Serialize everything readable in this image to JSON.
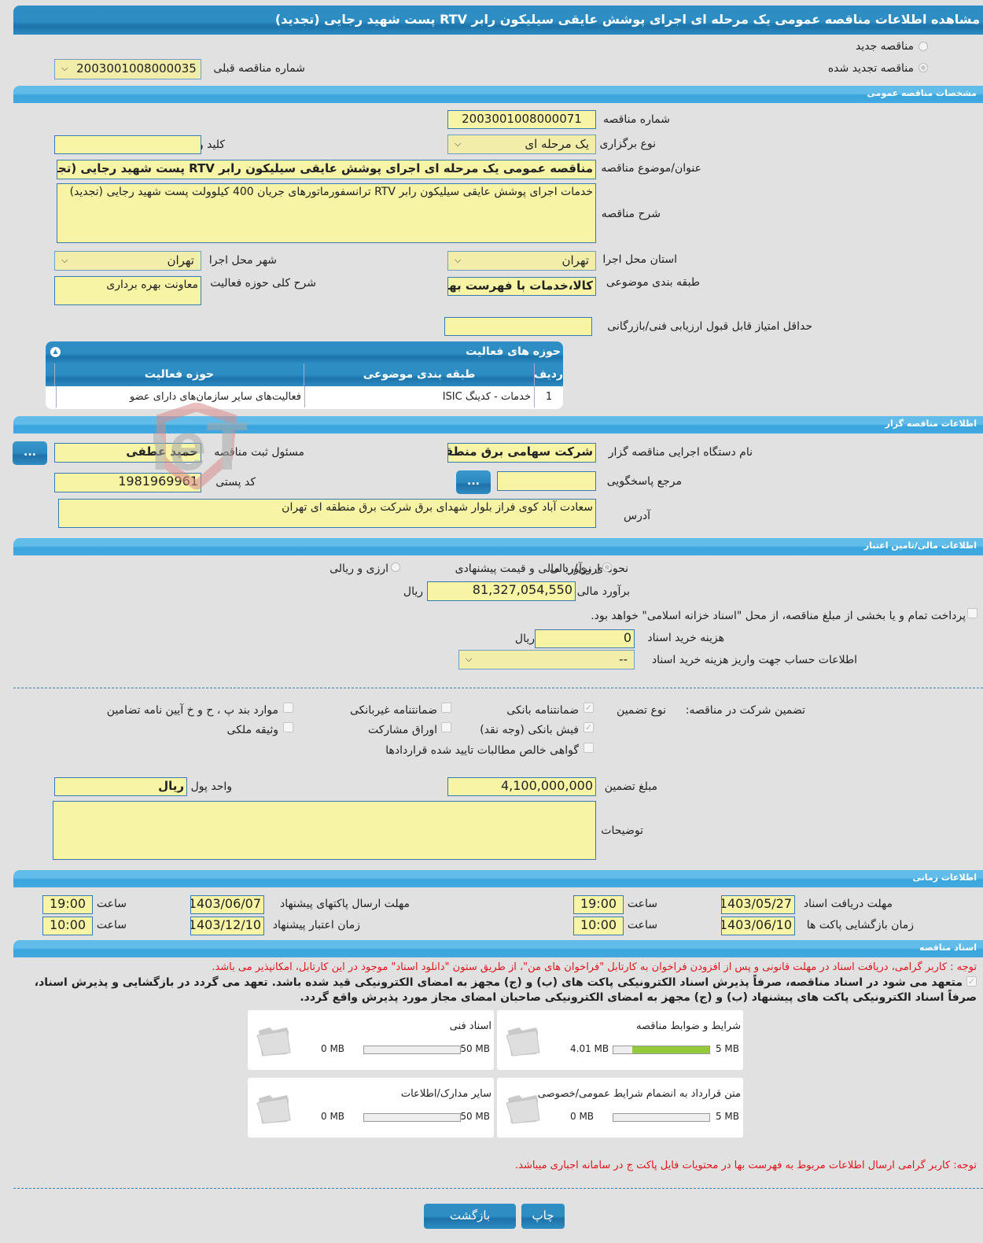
{
  "page_title": "مشاهده اطلاعات مناقصه عمومی یک مرحله ای اجرای پوشش عایقی سیلیکون رابر RTV پست شهید رجایی (تجدید)",
  "tender_type": {
    "new_label": "مناقصه جدید",
    "renewed_label": "مناقصه تجدید شده",
    "selected": "renewed",
    "previous_number_label": "شماره مناقصه قبلی",
    "previous_number": "2003001008000035"
  },
  "general": {
    "section_title": "مشخصات مناقصه عمومی",
    "number_label": "شماره مناقصه",
    "number": "2003001008000071",
    "holding_type_label": "نوع برگزاری",
    "holding_type": "یک مرحله ای",
    "keyword_label": "کلید واژه",
    "keyword": "",
    "subject_label": "عنوان/موضوع مناقصه",
    "subject": "مناقصه عمومی یک مرحله ای اجرای پوشش عایقی سیلیکون رابر RTV پست شهید رجایی (تجدید)",
    "description_label": "شرح مناقصه",
    "description": "خدمات اجرای پوشش عایقی سیلیکون رابر RTV ترانسفورماتورهای جریان 400 کیلوولت پست شهید رجایی (تجدید)",
    "province_label": "استان محل اجرا",
    "province": "تهران",
    "city_label": "شهر محل اجرا",
    "city": "تهران",
    "category_label": "طبقه بندی موضوعی",
    "category": "کالا،خدمات با فهرست بها،خ",
    "activity_scope_label": "شرح کلی حوزه فعالیت",
    "activity_scope": "معاونت بهره برداری",
    "min_score_label": "حداقل امتیاز قابل قبول ارزیابی فنی/بازرگانی",
    "min_score": ""
  },
  "activity_table": {
    "title": "حوزه های فعالیت",
    "columns": [
      "ردیف",
      "طبقه بندی موضوعی",
      "حوزه فعالیت"
    ],
    "rows": [
      [
        "1",
        "خدمات - کدینگ ISIC",
        "فعالیت‌های سایر سازمان‌های دارای عضو"
      ]
    ]
  },
  "organizer": {
    "section_title": "اطلاعات مناقصه گزار",
    "org_label": "نام دستگاه اجرایی مناقصه گزار",
    "org": "شرکت سهامی برق منطقه",
    "registrar_label": "مسئول ثبت مناقصه",
    "registrar": "حمید عطفی",
    "reference_label": "مرجع پاسخگویی",
    "reference": "",
    "postal_label": "کد پستی",
    "postal": "1981969961",
    "address_label": "آدرس",
    "address": "سعادت آباد کوی فراز بلوار شهدای برق شرکت برق منطقه ای تهران",
    "dots_label": "..."
  },
  "financial": {
    "section_title": "اطلاعات مالی/تامین اعتبار",
    "method_label": "نحوه ی برآورد مالی و قیمت پیشنهادی",
    "option_rial": "ارزی/ریالی",
    "option_both": "ارزی و ریالی",
    "estimate_label": "برآورد مالی",
    "estimate": "81,327,054,550",
    "currency": "ریال",
    "treasury_text": "پرداخت تمام و یا بخشی از مبلغ مناقصه، از محل \"اسناد خزانه اسلامی\" خواهد بود.",
    "doc_fee_label": "هزینه خرید اسناد",
    "doc_fee": "0",
    "doc_fee_currency": "ریال",
    "account_label": "اطلاعات حساب جهت واریز هزینه خرید اسناد",
    "account": "--"
  },
  "guarantee": {
    "title_label": "تضمین شرکت در مناقصه:",
    "type_label": "نوع تضمین",
    "options": [
      {
        "label": "ضمانتنامه بانکی",
        "checked": true
      },
      {
        "label": "ضمانتنامه غیربانکی",
        "checked": false
      },
      {
        "label": "موارد بند پ ، ح و خ آیین نامه تضامین",
        "checked": false
      },
      {
        "label": "فیش بانکی (وجه نقد)",
        "checked": true
      },
      {
        "label": "اوراق مشارکت",
        "checked": false
      },
      {
        "label": "وثیقه ملکی",
        "checked": false
      },
      {
        "label": "گواهی خالص مطالبات تایید شده قراردادها",
        "checked": false
      }
    ],
    "amount_label": "مبلغ تضمین",
    "amount": "4,100,000,000",
    "unit_label": "واحد پول",
    "unit": "ریال",
    "notes_label": "توضیحات",
    "notes": ""
  },
  "timing": {
    "section_title": "اطلاعات زمانی",
    "doc_deadline_label": "مهلت دریافت اسناد",
    "doc_deadline_date": "1403/05/27",
    "doc_deadline_time": "19:00",
    "submit_deadline_label": "مهلت ارسال پاکتهای پیشنهاد",
    "submit_deadline_date": "1403/06/07",
    "submit_deadline_time": "19:00",
    "opening_label": "زمان بازگشایی پاکت ها",
    "opening_date": "1403/06/10",
    "opening_time": "10:00",
    "validity_label": "زمان اعتبار پیشنهاد",
    "validity_date": "1403/12/10",
    "validity_time": "10:00",
    "time_label": "ساعت"
  },
  "documents": {
    "section_title": "اسناد مناقصه",
    "notice": "توجه : کاربر گرامی، دریافت اسناد در مهلت قانونی و پس از افزودن فراخوان به کارتابل \"فراخوان های من\"، از طریق ستون \"دانلود اسناد\" موجود در این کارتابل، امکانپذیر می باشد.",
    "commitment_line1": "متعهد می شود در اسناد مناقصه، صرفاً پذیرش اسناد الکترونیکی پاکت های (ب) و (ج) مجهز به امضای الکترونیکی قید شده باشد. تعهد می گردد در بازگشایی و پذیرش اسناد،",
    "commitment_line2": "صرفاً اسناد الکترونیکی پاکت های پیشنهاد (ب) و (ج) مجهز به امضای الکترونیکی صاحبان امضای مجاز مورد پذیرش واقع گردد.",
    "cards": [
      {
        "name": "شرایط و ضوابط مناقصه",
        "used": "4.01 MB",
        "max": "5 MB",
        "fill_fraction": 0.8
      },
      {
        "name": "اسناد فنی",
        "used": "0 MB",
        "max": "50 MB",
        "fill_fraction": 0
      },
      {
        "name": "متن قرارداد به انضمام شرایط عمومی/خصوصی",
        "used": "0 MB",
        "max": "5 MB",
        "fill_fraction": 0
      },
      {
        "name": "سایر مدارک/اطلاعات",
        "used": "0 MB",
        "max": "50 MB",
        "fill_fraction": 0
      }
    ],
    "price_list_notice": "توجه: کاربر گرامی ارسال اطلاعات مربوط به فهرست بها در محتویات فایل پاکت ج در سامانه اجباری میباشد."
  },
  "actions": {
    "print_label": "چاپ",
    "back_label": "بازگشت"
  },
  "watermark": "AriaTender.neT"
}
